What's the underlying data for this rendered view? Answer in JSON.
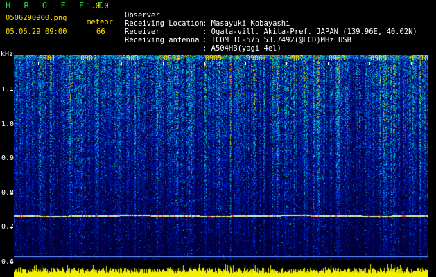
{
  "header": {
    "app_title": "H R O F F T",
    "version": "1.0.0",
    "filename": "0506290900.png",
    "mode_label": "meteor",
    "datetime": "05.06.29 09:00",
    "count": "66"
  },
  "info": [
    {
      "key": "Observer",
      "value": ": Masayuki Kobayashi"
    },
    {
      "key": "Receiving Location",
      "value": ": Ogata-vill. Akita-Pref. JAPAN (139.96E, 40.02N)"
    },
    {
      "key": "Receiver",
      "value": ": ICOM IC-575 53.7492(@LCD)MHz USB"
    },
    {
      "key": "Receiving antenna",
      "value": ": A504HB(yagi 4el)"
    }
  ],
  "axis": {
    "y_unit": "kHz",
    "y_ticks": [
      "1.1",
      "1.0",
      "0.9",
      "0.8",
      "0.7",
      "0.6"
    ],
    "x_ticks": [
      "0901",
      "0902",
      "0903",
      "0904",
      "0905",
      "0906",
      "0907",
      "0908",
      "0909",
      "0910"
    ]
  },
  "colors": {
    "background": "#000000",
    "title_green": "#27d33a",
    "header_yellow": "#ffe000",
    "text_white": "#ffffff",
    "tick_label_yellow": "#ffe000"
  }
}
